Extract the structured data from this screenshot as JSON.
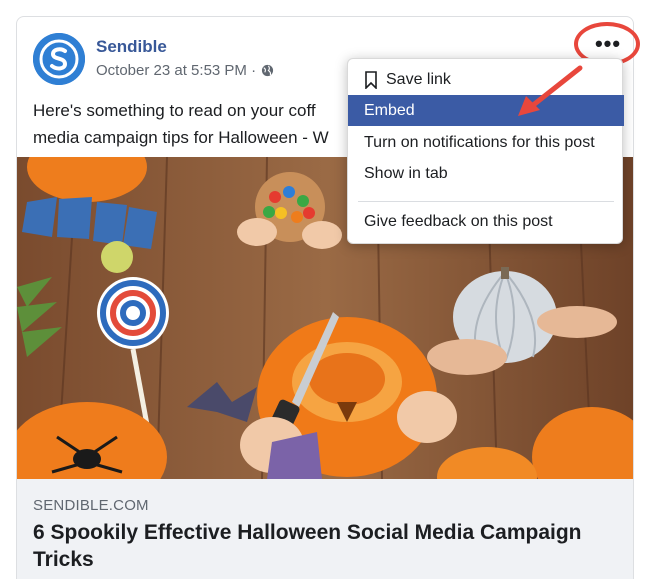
{
  "post": {
    "author": "Sendible",
    "timestamp": "October 23 at 5:53 PM ·",
    "visibility_icon": "globe-icon",
    "text_line1": "Here's something to read on your coff",
    "text_line2": "media campaign tips for Halloween - W"
  },
  "link_preview": {
    "domain": "SENDIBLE.COM",
    "title": "6 Spookily Effective Halloween Social Media Campaign Tricks"
  },
  "more_button": {
    "label": "•••"
  },
  "menu": {
    "items": [
      {
        "label": "Save link",
        "icon": "bookmark-icon"
      },
      {
        "label": "Embed",
        "active": true
      },
      {
        "label": "Turn on notifications for this post"
      },
      {
        "label": "Show in tab"
      },
      {
        "label": "Give feedback on this post"
      }
    ]
  },
  "colors": {
    "brand_blue": "#2f7fd4",
    "author_link": "#385898",
    "menu_highlight": "#3b5ba5",
    "annotation_red": "#e8473c"
  }
}
